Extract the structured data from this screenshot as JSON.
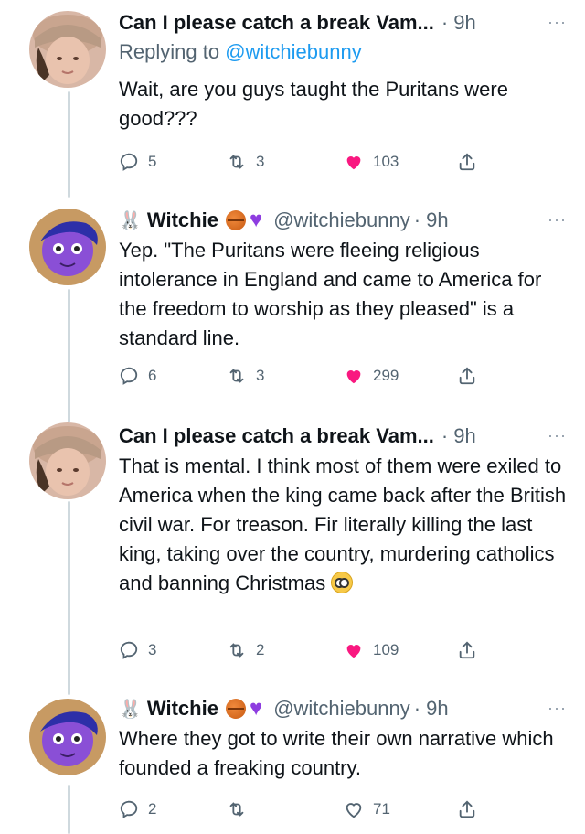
{
  "tweets": [
    {
      "name": "Can I please catch a break Vam...",
      "handle": "",
      "time": "· 9h",
      "replying_prefix": "Replying to ",
      "replying_handle": "@witchiebunny",
      "text": "Wait, are you guys taught the Puritans were good???",
      "replies": "5",
      "retweets": "3",
      "likes": "103",
      "liked": true
    },
    {
      "name": "Witchie",
      "handle": "@witchiebunny",
      "time": "· 9h",
      "text": "Yep. \"The Puritans were fleeing religious intolerance in England and came to America for the freedom to worship as they pleased\" is a standard line.",
      "replies": "6",
      "retweets": "3",
      "likes": "299",
      "liked": true
    },
    {
      "name": "Can I please catch a break Vam...",
      "handle": "",
      "time": "· 9h",
      "text": "That is mental. I think most of them were exiled to America when the king came back after the British civil war. For treason. Fir literally killing the last king, taking over the country, murdering catholics and banning Christmas",
      "replies": "3",
      "retweets": "2",
      "likes": "109",
      "liked": true
    },
    {
      "name": "Witchie",
      "handle": "@witchiebunny",
      "time": "· 9h",
      "text": "Where they got to write their own narrative which founded a freaking country.",
      "replies": "2",
      "retweets": "",
      "likes": "71",
      "liked": false
    }
  ],
  "icons": {
    "more": "more-icon",
    "reply": "reply-icon",
    "retweet": "retweet-icon",
    "like": "heart-icon",
    "share": "share-icon"
  },
  "colors": {
    "link": "#1d9bf0",
    "like": "#f91880",
    "muted": "#536471",
    "thread": "#cfd9de"
  }
}
